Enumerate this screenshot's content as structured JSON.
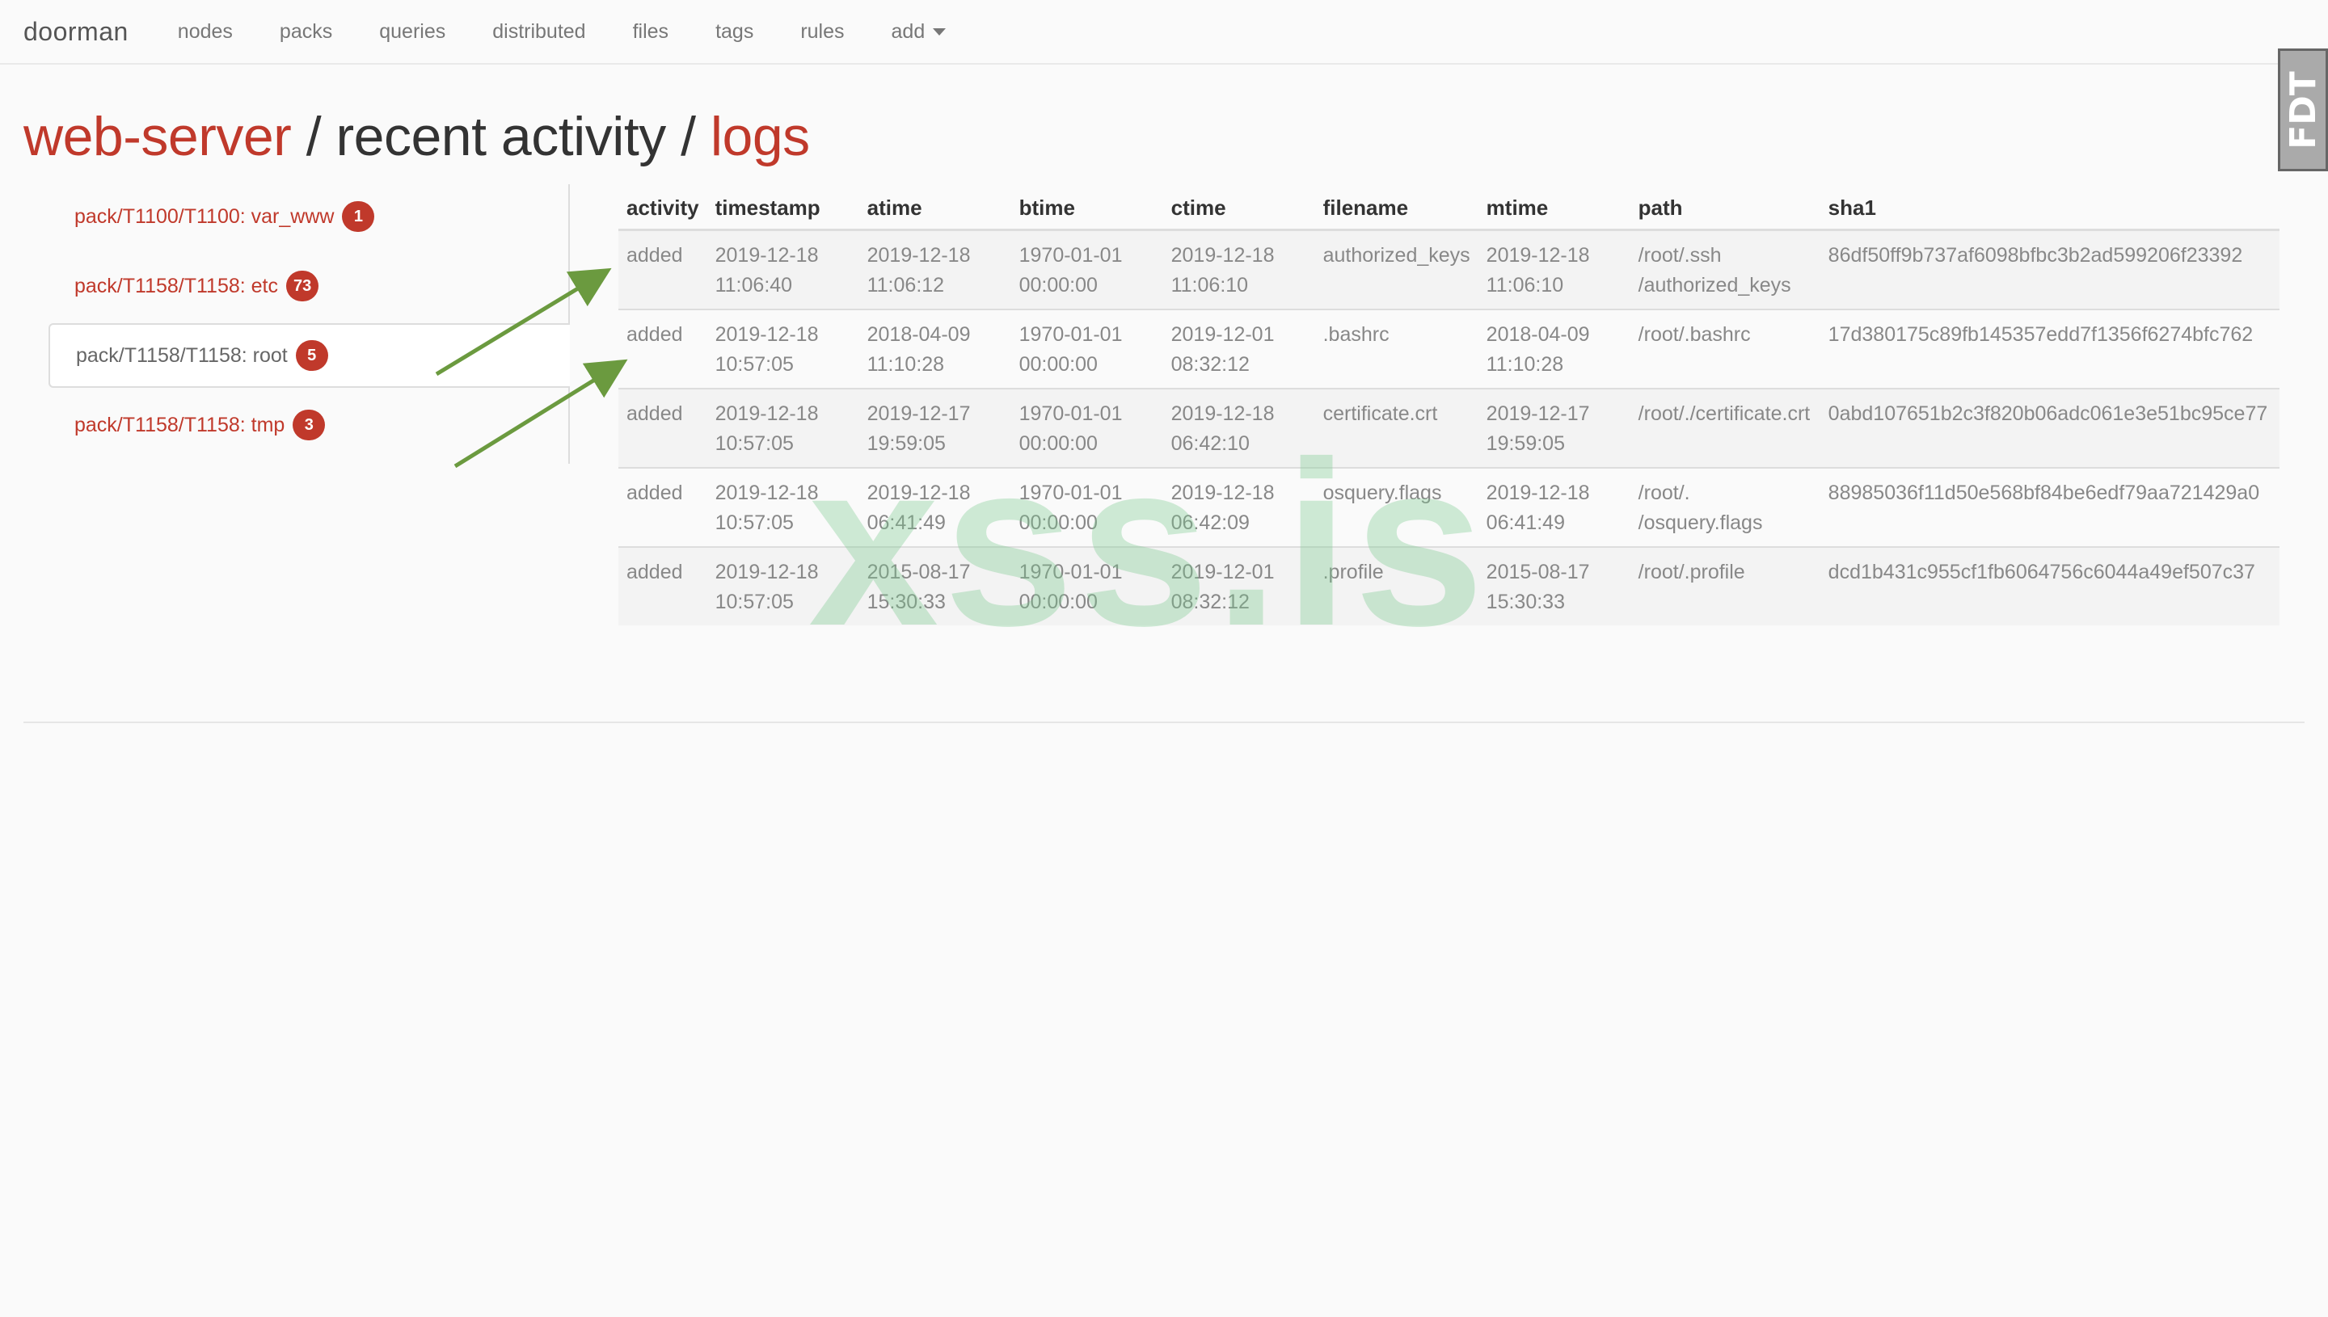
{
  "nav": {
    "brand": "doorman",
    "items": [
      "nodes",
      "packs",
      "queries",
      "distributed",
      "files",
      "tags",
      "rules"
    ],
    "add_label": "add"
  },
  "title": {
    "host": "web-server",
    "sep1": " / ",
    "section": "recent activity",
    "sep2": " / ",
    "current": "logs"
  },
  "sidebar": {
    "items": [
      {
        "label": "pack/T1100/T1100: var_www",
        "count": "1",
        "active": false
      },
      {
        "label": "pack/T1158/T1158: etc",
        "count": "73",
        "active": false
      },
      {
        "label": "pack/T1158/T1158: root",
        "count": "5",
        "active": true
      },
      {
        "label": "pack/T1158/T1158: tmp",
        "count": "3",
        "active": false
      }
    ]
  },
  "table": {
    "headers": [
      "activity",
      "timestamp",
      "atime",
      "btime",
      "ctime",
      "filename",
      "mtime",
      "path",
      "sha1"
    ],
    "rows": [
      [
        "added",
        "2019-12-18\n11:06:40",
        "2019-12-18\n11:06:12",
        "1970-01-01\n00:00:00",
        "2019-12-18\n11:06:10",
        "authorized_keys",
        "2019-12-18\n11:06:10",
        "/root/.ssh\n/authorized_keys",
        "86df50ff9b737af6098bfbc3b2ad599206f23392"
      ],
      [
        "added",
        "2019-12-18\n10:57:05",
        "2018-04-09\n11:10:28",
        "1970-01-01\n00:00:00",
        "2019-12-01\n08:32:12",
        ".bashrc",
        "2018-04-09\n11:10:28",
        "/root/.bashrc",
        "17d380175c89fb145357edd7f1356f6274bfc762"
      ],
      [
        "added",
        "2019-12-18\n10:57:05",
        "2019-12-17\n19:59:05",
        "1970-01-01\n00:00:00",
        "2019-12-18\n06:42:10",
        "certificate.crt",
        "2019-12-17\n19:59:05",
        "/root/./certificate.crt",
        "0abd107651b2c3f820b06adc061e3e51bc95ce77"
      ],
      [
        "added",
        "2019-12-18\n10:57:05",
        "2019-12-18\n06:41:49",
        "1970-01-01\n00:00:00",
        "2019-12-18\n06:42:09",
        "osquery.flags",
        "2019-12-18\n06:41:49",
        "/root/.\n/osquery.flags",
        "88985036f11d50e568bf84be6edf79aa721429a0"
      ],
      [
        "added",
        "2019-12-18\n10:57:05",
        "2015-08-17\n15:30:33",
        "1970-01-01\n00:00:00",
        "2019-12-01\n08:32:12",
        ".profile",
        "2015-08-17\n15:30:33",
        "/root/.profile",
        "dcd1b431c955cf1fb6064756c6044a49ef507c37"
      ]
    ]
  },
  "watermark": "xss.is",
  "corner_badge": "FDT",
  "colors": {
    "accent": "#c0392b",
    "arrow": "#6b9a3f"
  }
}
